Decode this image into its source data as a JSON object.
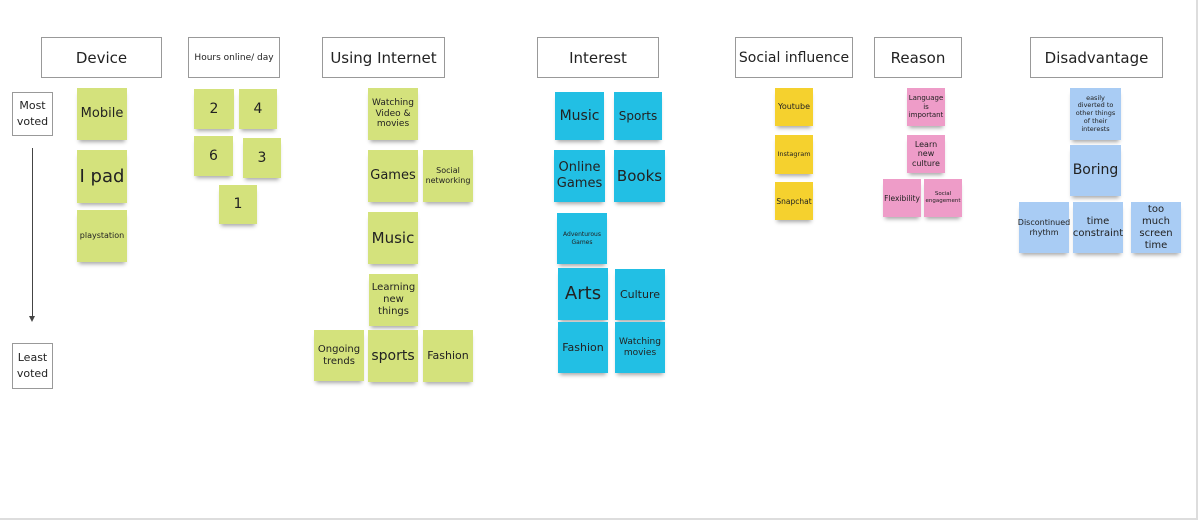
{
  "colors": {
    "green": "#d4e27c",
    "blue": "#22bfe4",
    "yellow": "#f5d12e",
    "pink": "#ee9cc8",
    "lightblue": "#a9ccf4"
  },
  "scale": {
    "top_label": "Most voted",
    "bottom_label": "Least voted"
  },
  "columns": [
    {
      "header": "Device",
      "color": "green",
      "notes": [
        "Mobile",
        "I pad",
        "playstation"
      ]
    },
    {
      "header": "Hours online/ day",
      "color": "green",
      "notes": [
        "2",
        "4",
        "6",
        "3",
        "1"
      ]
    },
    {
      "header": "Using Internet",
      "color": "green",
      "notes": [
        "Watching Video & movies",
        "Games",
        "Social networking",
        "Music",
        "Learning new things",
        "Ongoing trends",
        "sports",
        "Fashion"
      ]
    },
    {
      "header": "Interest",
      "color": "blue",
      "notes": [
        "Music",
        "Sports",
        "Online Games",
        "Books",
        "Adventurous Games",
        "Arts",
        "Culture",
        "Fashion",
        "Watching movies"
      ]
    },
    {
      "header": "Social influence",
      "color": "yellow",
      "notes": [
        "Youtube",
        "Instagram",
        "Snapchat"
      ]
    },
    {
      "header": "Reason",
      "color": "pink",
      "notes": [
        "Language is important",
        "Learn new culture",
        "Flexibility",
        "Social engagement"
      ]
    },
    {
      "header": "Disadvantage",
      "color": "lightblue",
      "notes": [
        "easily diverted to other things of their interests",
        "Boring",
        "Discontinued rhythm",
        "time constraint",
        "too much screen time"
      ]
    }
  ]
}
